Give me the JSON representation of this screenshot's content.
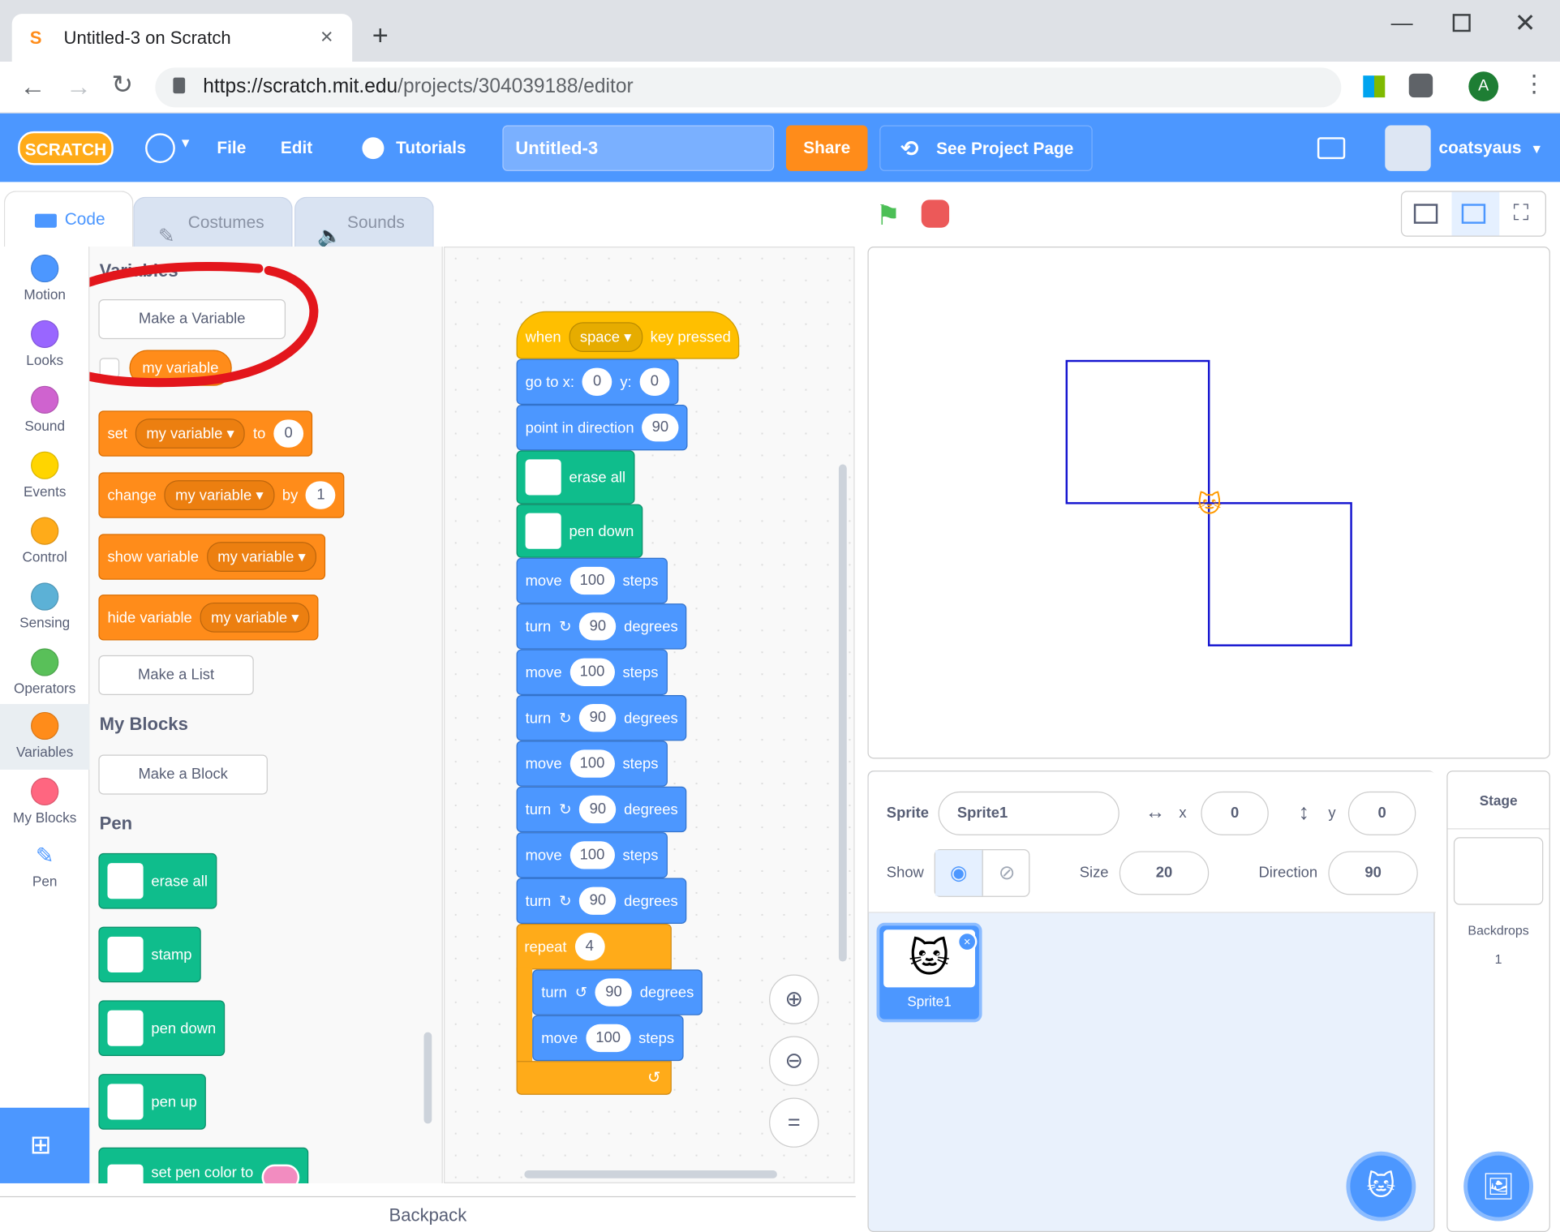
{
  "browser": {
    "tab_title": "Untitled-3 on Scratch",
    "url_host": "https://scratch.mit.edu",
    "url_path": "/projects/304039188/editor",
    "profile_initial": "A"
  },
  "menubar": {
    "file": "File",
    "edit": "Edit",
    "tutorials": "Tutorials",
    "project_title": "Untitled-3",
    "share": "Share",
    "see_project": "See Project Page",
    "username": "coatsyaus"
  },
  "tabs": {
    "code": "Code",
    "costumes": "Costumes",
    "sounds": "Sounds"
  },
  "categories": [
    {
      "label": "Motion",
      "color": "#4c97ff"
    },
    {
      "label": "Looks",
      "color": "#9966ff"
    },
    {
      "label": "Sound",
      "color": "#cf63cf"
    },
    {
      "label": "Events",
      "color": "#ffd500"
    },
    {
      "label": "Control",
      "color": "#ffab19"
    },
    {
      "label": "Sensing",
      "color": "#5cb1d6"
    },
    {
      "label": "Operators",
      "color": "#59c059"
    },
    {
      "label": "Variables",
      "color": "#ff8c1a"
    },
    {
      "label": "My Blocks",
      "color": "#ff6680"
    },
    {
      "label": "Pen",
      "color": "#0fbd8c"
    }
  ],
  "palette": {
    "variables_heading": "Variables",
    "make_variable": "Make a Variable",
    "var_name": "my variable",
    "set_label": "set",
    "to_label": "to",
    "set_value": "0",
    "change_label": "change",
    "by_label": "by",
    "change_value": "1",
    "show_variable": "show variable",
    "hide_variable": "hide variable",
    "make_list": "Make a List",
    "myblocks_heading": "My Blocks",
    "make_block": "Make a Block",
    "pen_heading": "Pen",
    "erase_all": "erase all",
    "stamp": "stamp",
    "pen_down": "pen down",
    "pen_up": "pen up",
    "set_pen_color": "set pen color to"
  },
  "script": {
    "when": "when",
    "key": "space",
    "key_pressed": "key pressed",
    "goto": "go to x:",
    "goto_x": "0",
    "goto_y_label": "y:",
    "goto_y": "0",
    "point": "point in direction",
    "point_value": "90",
    "erase_all": "erase all",
    "pen_down": "pen down",
    "move": "move",
    "steps": "steps",
    "move_value": "100",
    "turn": "turn",
    "degrees": "degrees",
    "turn_value": "90",
    "repeat": "repeat",
    "repeat_value": "4"
  },
  "sprite": {
    "sprite_label": "Sprite",
    "name": "Sprite1",
    "x_label": "x",
    "x": "0",
    "y_label": "y",
    "y": "0",
    "show_label": "Show",
    "size_label": "Size",
    "size": "20",
    "direction_label": "Direction",
    "direction": "90",
    "thumb_name": "Sprite1"
  },
  "stage_panel": {
    "title": "Stage",
    "backdrops_label": "Backdrops",
    "backdrops_count": "1"
  },
  "backpack": "Backpack",
  "colors": {
    "scratch_blue": "#4c97ff",
    "annotation_red": "#e3161c"
  }
}
